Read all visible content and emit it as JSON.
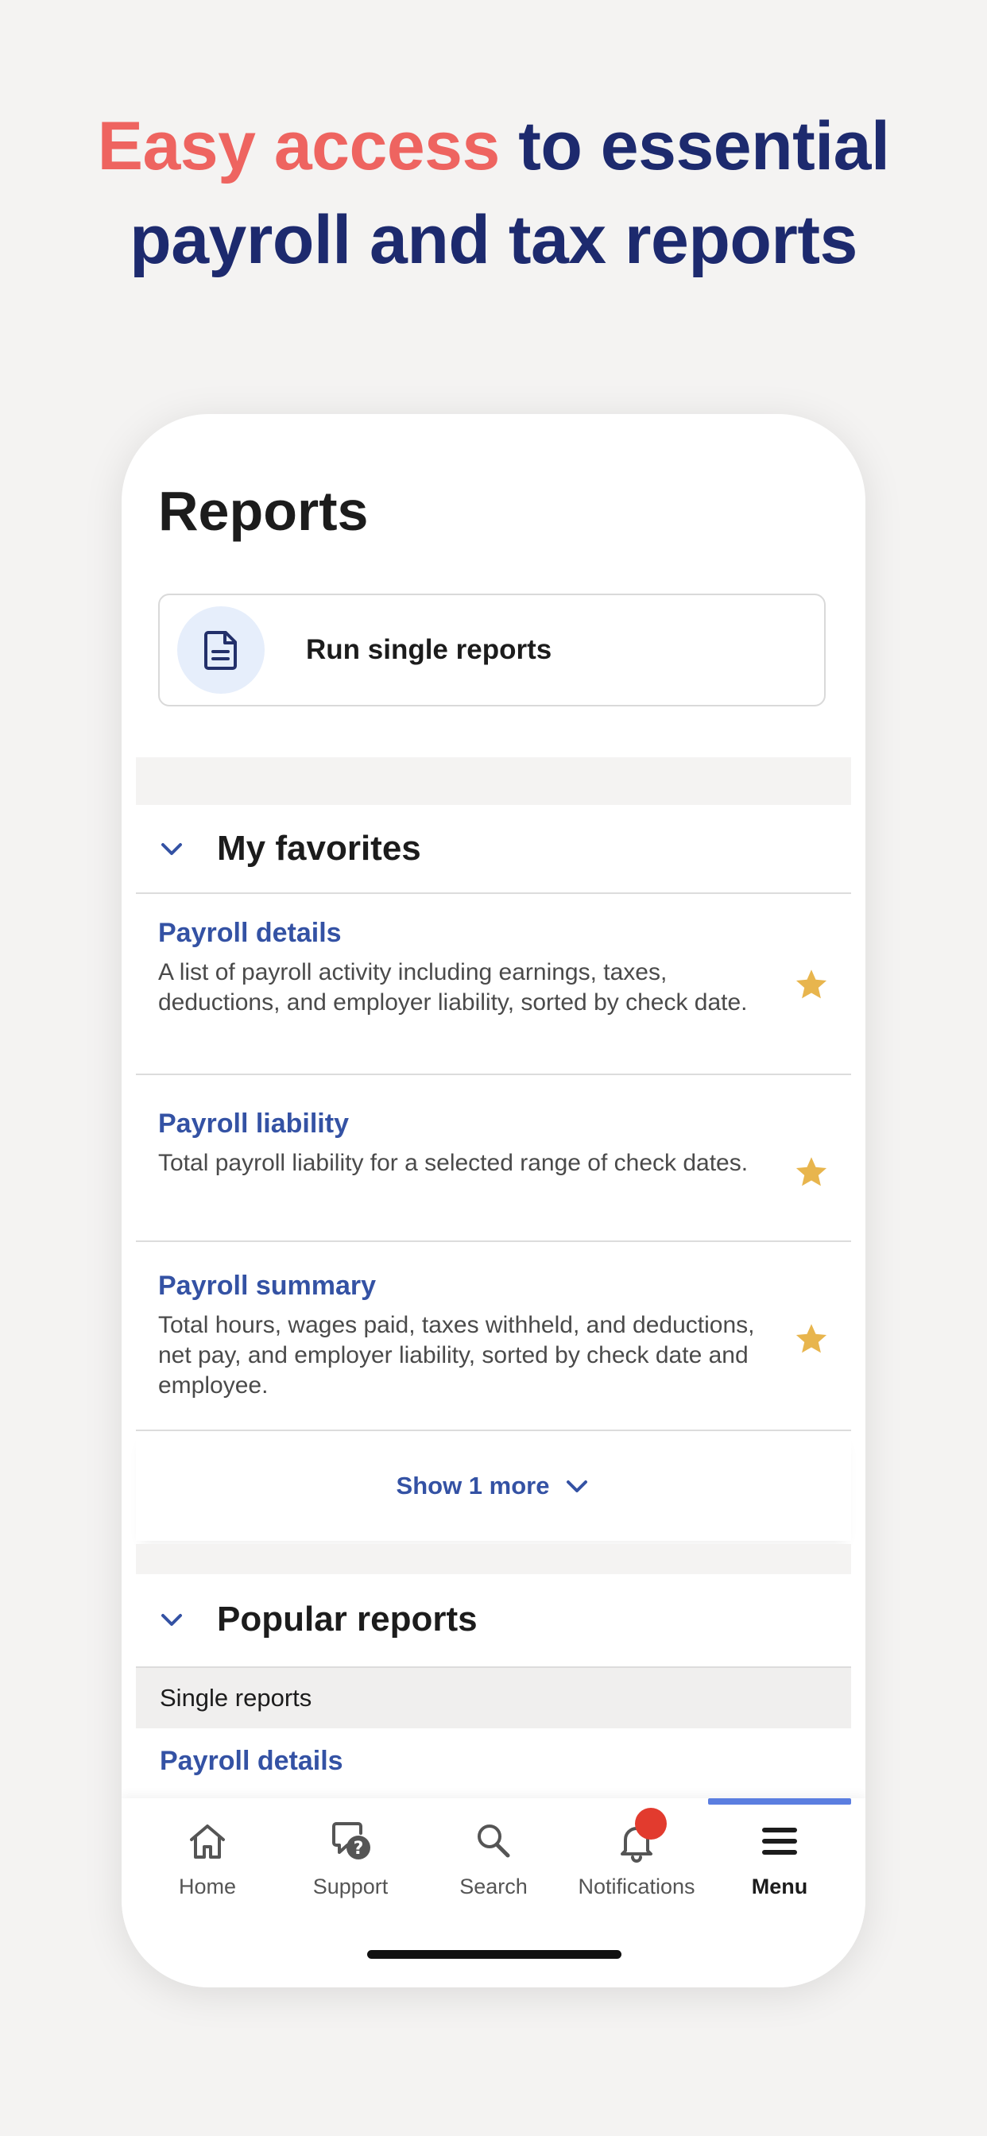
{
  "headline": {
    "accent": "Easy access",
    "rest_line1": " to essential",
    "line2": "payroll and tax reports"
  },
  "page": {
    "title": "Reports"
  },
  "run_card": {
    "label": "Run single reports",
    "icon": "document-icon"
  },
  "favorites": {
    "title": "My favorites",
    "items": [
      {
        "title": "Payroll details",
        "desc": "A list of payroll activity including earnings, taxes, deductions, and employer liability, sorted by check date.",
        "starred": true
      },
      {
        "title": "Payroll liability",
        "desc": "Total payroll liability for a selected range of check dates.",
        "starred": true
      },
      {
        "title": "Payroll summary",
        "desc": "Total hours, wages paid, taxes withheld, and deductions, net pay, and employer liability, sorted by check date and employee.",
        "starred": true
      }
    ],
    "show_more": "Show 1 more"
  },
  "popular": {
    "title": "Popular reports",
    "subheader": "Single reports",
    "first_item": "Payroll details"
  },
  "tabbar": {
    "active": "Menu",
    "items": [
      {
        "label": "Home",
        "icon": "home-icon"
      },
      {
        "label": "Support",
        "icon": "support-icon"
      },
      {
        "label": "Search",
        "icon": "search-icon"
      },
      {
        "label": "Notifications",
        "icon": "bell-icon",
        "badge": true
      },
      {
        "label": "Menu",
        "icon": "menu-icon"
      }
    ]
  },
  "colors": {
    "accent_red": "#ee6460",
    "navy": "#1d2a6e",
    "link_blue": "#3452a4",
    "star": "#e8b54d",
    "tab_indicator": "#5b7ee0",
    "badge_red": "#e23b2e"
  }
}
